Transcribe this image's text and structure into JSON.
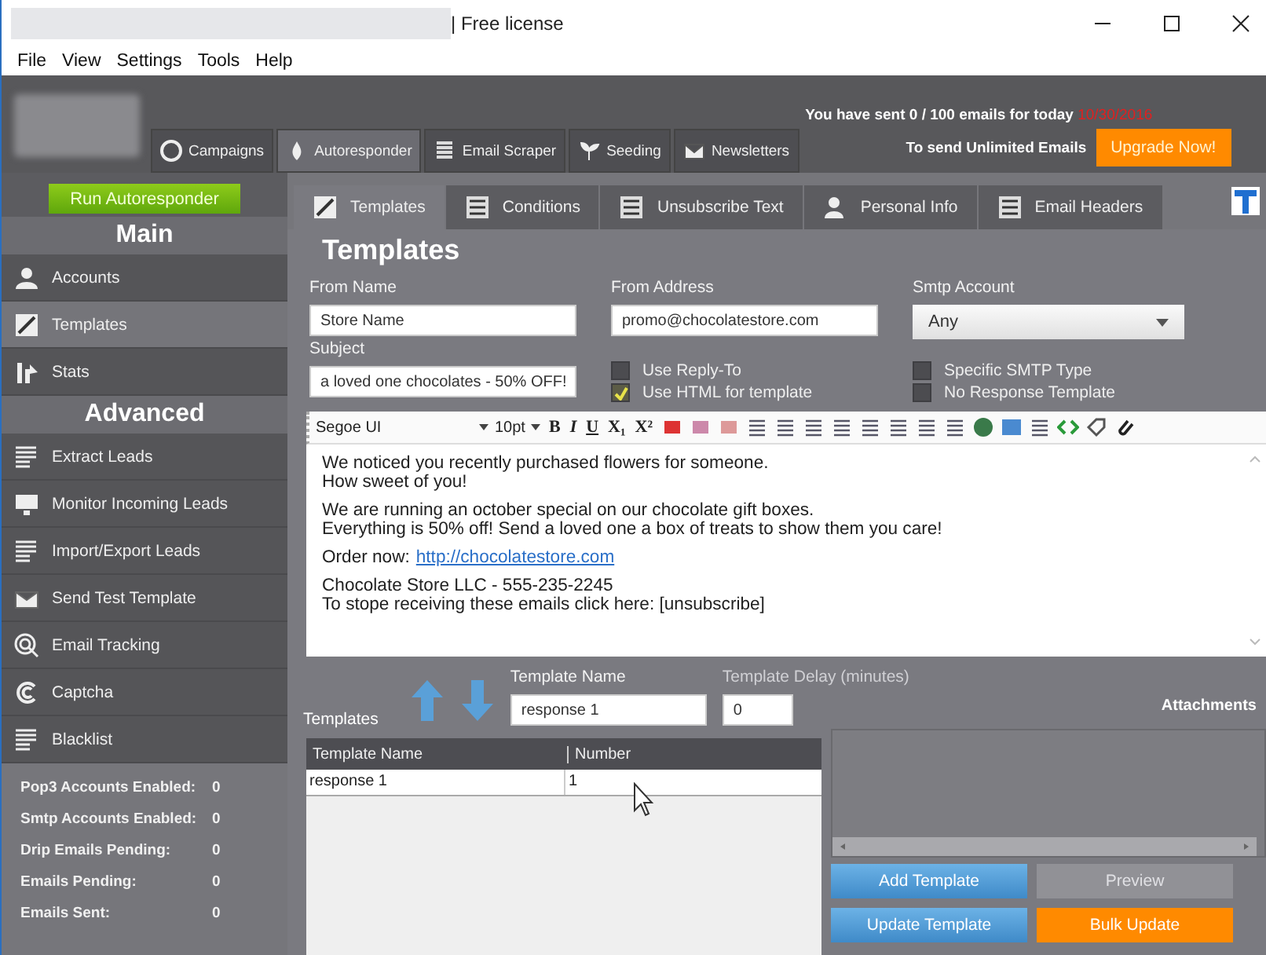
{
  "window": {
    "title": "| Free license"
  },
  "menu": [
    "File",
    "View",
    "Settings",
    "Tools",
    "Help"
  ],
  "header": {
    "sent_text": "You have sent 0 / 100 emails for today",
    "date": "10/30/2016",
    "unlimited_text": "To send Unlimited Emails",
    "upgrade_button": "Upgrade Now!"
  },
  "main_tabs": [
    {
      "label": "Campaigns",
      "selected": false
    },
    {
      "label": "Autoresponder",
      "selected": true
    },
    {
      "label": "Email Scraper",
      "selected": false
    },
    {
      "label": "Seeding",
      "selected": false
    },
    {
      "label": "Newsletters",
      "selected": false
    }
  ],
  "sidebar": {
    "run_button": "Run Autoresponder",
    "sections": [
      {
        "title": "Main",
        "items": [
          {
            "label": "Accounts",
            "selected": false
          },
          {
            "label": "Templates",
            "selected": true
          },
          {
            "label": "Stats",
            "selected": false
          }
        ]
      },
      {
        "title": "Advanced",
        "items": [
          {
            "label": "Extract Leads",
            "selected": false
          },
          {
            "label": "Monitor Incoming Leads",
            "selected": false
          },
          {
            "label": "Import/Export Leads",
            "selected": false
          },
          {
            "label": "Send Test Template",
            "selected": false
          },
          {
            "label": "Email Tracking",
            "selected": false
          },
          {
            "label": "Captcha",
            "selected": false
          },
          {
            "label": "Blacklist",
            "selected": false
          }
        ]
      }
    ],
    "stats": [
      {
        "label": "Pop3 Accounts Enabled:",
        "value": "0"
      },
      {
        "label": "Smtp Accounts Enabled:",
        "value": "0"
      },
      {
        "label": "Drip Emails Pending:",
        "value": "0"
      },
      {
        "label": "Emails Pending:",
        "value": "0"
      },
      {
        "label": "Emails Sent:",
        "value": "0"
      }
    ]
  },
  "sub_tabs": [
    {
      "label": "Templates",
      "selected": true
    },
    {
      "label": "Conditions",
      "selected": false
    },
    {
      "label": "Unsubscribe Text",
      "selected": false
    },
    {
      "label": "Personal Info",
      "selected": false
    },
    {
      "label": "Email Headers",
      "selected": false
    }
  ],
  "page_title": "Templates",
  "form": {
    "from_name": {
      "label": "From Name",
      "value": "Store Name"
    },
    "from_address": {
      "label": "From Address",
      "value": "promo@chocolatestore.com"
    },
    "smtp_account": {
      "label": "Smtp Account",
      "value": "Any"
    },
    "subject": {
      "label": "Subject",
      "value": "a loved one chocolates - 50% OFF!"
    },
    "checkboxes": [
      {
        "label": "Use Reply-To",
        "checked": false
      },
      {
        "label": "Use HTML for template",
        "checked": true
      },
      {
        "label": "Specific SMTP Type",
        "checked": false
      },
      {
        "label": "No Response Template",
        "checked": false
      }
    ]
  },
  "editor": {
    "font": "Segoe UI",
    "size": "10pt",
    "format_buttons": [
      "B",
      "I",
      "U",
      "X₁",
      "X²"
    ],
    "paragraphs": [
      {
        "lines": [
          "We noticed you recently purchased flowers for someone.",
          "How sweet of you!"
        ]
      },
      {
        "lines": [
          "We are running an october special on our chocolate gift boxes.",
          "Everything is 50% off! Send a loved one a box of treats to show them you care!"
        ]
      },
      {
        "lines": [
          "Order now:"
        ],
        "link": "http://chocolatestore.com"
      },
      {
        "lines": [
          "Chocolate Store LLC - 555-235-2245",
          "To stope receiving these emails click here: [unsubscribe]"
        ]
      }
    ]
  },
  "templates_panel": {
    "label": "Templates",
    "name_label": "Template Name",
    "name_value": "response 1",
    "delay_label": "Template Delay (minutes)",
    "delay_value": "0",
    "attachments_label": "Attachments",
    "table": {
      "columns": [
        "Template Name",
        "Number"
      ],
      "rows": [
        [
          "response 1",
          "1"
        ]
      ]
    },
    "buttons": [
      {
        "label": "Add Template",
        "kind": "blue",
        "disabled": false
      },
      {
        "label": "Preview",
        "kind": "grey",
        "disabled": true
      },
      {
        "label": "Update Template",
        "kind": "blue",
        "disabled": false
      },
      {
        "label": "Bulk Update",
        "kind": "orange",
        "disabled": false
      }
    ]
  }
}
